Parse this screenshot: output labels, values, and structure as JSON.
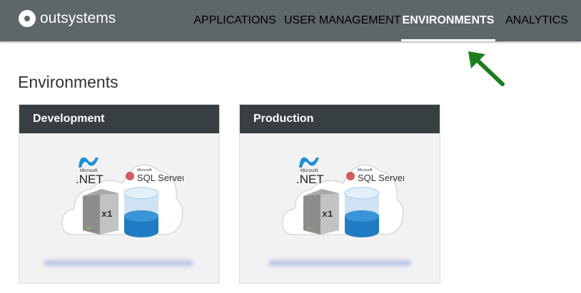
{
  "brand": {
    "name": "outsystems"
  },
  "nav": {
    "items": [
      {
        "label": "APPLICATIONS",
        "active": false
      },
      {
        "label": "USER MANAGEMENT",
        "active": false
      },
      {
        "label": "ENVIRONMENTS",
        "active": true
      },
      {
        "label": "ANALYTICS",
        "active": false
      }
    ]
  },
  "page": {
    "title": "Environments"
  },
  "environments": [
    {
      "name": "Development",
      "servers": "x1",
      "platform": ".NET",
      "platform_vendor": "Microsoft",
      "database": "SQL Server",
      "database_vendor": "Microsoft"
    },
    {
      "name": "Production",
      "servers": "x1",
      "platform": ".NET",
      "platform_vendor": "Microsoft",
      "database": "SQL Server",
      "database_vendor": "Microsoft"
    }
  ],
  "colors": {
    "header": "#5d6669",
    "card_header": "#373f40",
    "annotation_arrow": "#1e7d1e"
  }
}
